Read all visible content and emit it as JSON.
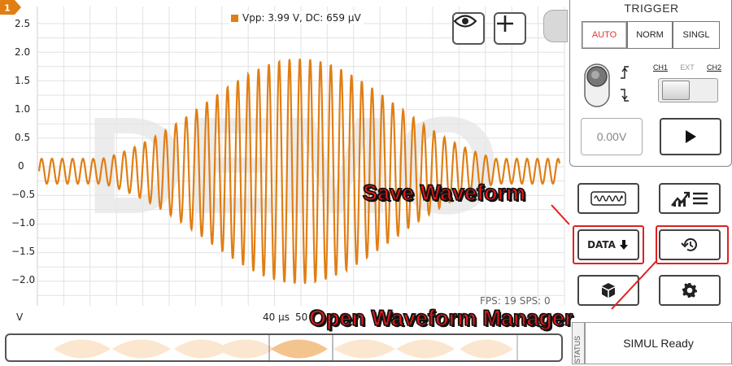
{
  "plot": {
    "y_ticks": [
      "2.5",
      "2.0",
      "1.5",
      "1.0",
      "0.5",
      "0",
      "−0.5",
      "−1.0",
      "−1.5",
      "−2.0"
    ],
    "y_unit": "V",
    "timebase": "40 μs",
    "timebase_partial": "50",
    "measurement": "Vpp: 3.99 V, DC: 659 μV",
    "fps_sps": "FPS: 19  SPS: 0",
    "channel_marker": "1",
    "watermark": "DEMO",
    "trace_color": "#e07e14"
  },
  "toolbar": {
    "eye_icon": "eye-icon",
    "plus_icon": "plus-icon"
  },
  "trigger": {
    "title": "TRIGGER",
    "modes": [
      "AUTO",
      "NORM",
      "SINGL"
    ],
    "active_mode": "AUTO",
    "source_labels": [
      "CH1",
      "EXT",
      "CH2"
    ],
    "level": "0.00V",
    "accent_color": "#e03a2e"
  },
  "buttons": {
    "data_label": "DATA",
    "icons": [
      "waveform-icon",
      "chart-list-icon",
      "download-arrow-icon",
      "history-icon",
      "cube-icon",
      "gear-icon"
    ]
  },
  "status": {
    "tab": "STATUS",
    "text": "SIMUL Ready"
  },
  "annotations": {
    "save": "Save Waveform",
    "open": "Open Waveform Manager"
  }
}
